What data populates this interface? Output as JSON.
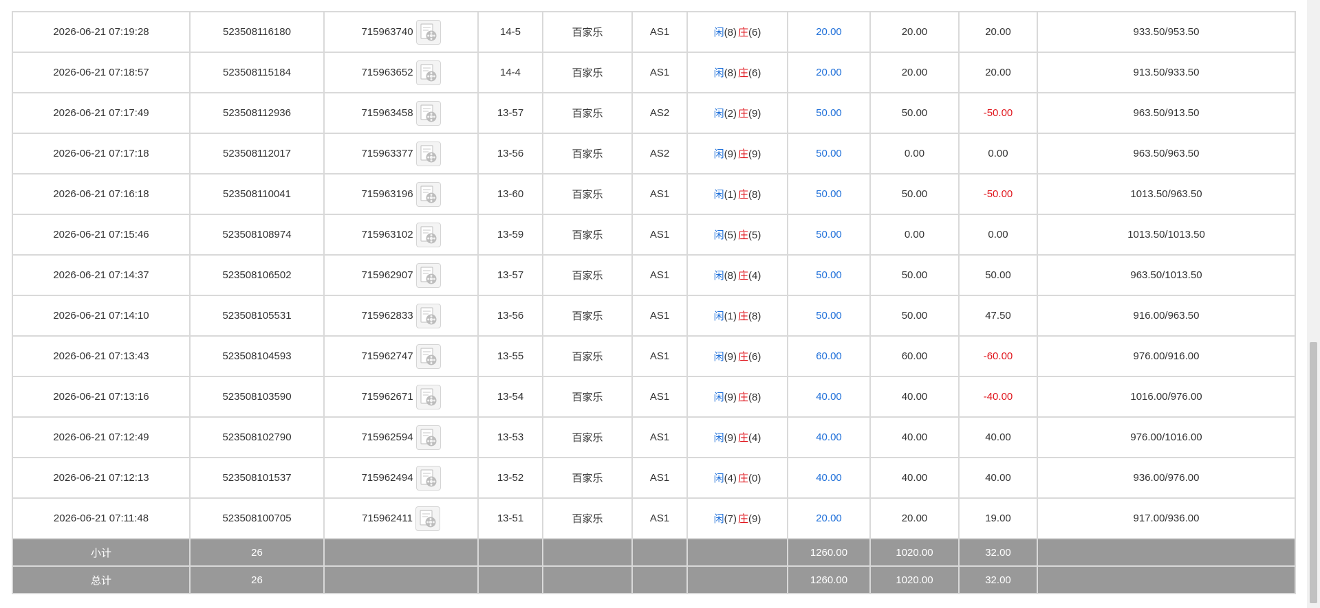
{
  "rows": [
    {
      "time": "2026-06-21 07:19:28",
      "order_no": "523508116180",
      "room_no": "715963740",
      "round": "14-5",
      "game": "百家乐",
      "table": "AS1",
      "player_label": "闲",
      "player_pts": "(8)",
      "banker_label": "庄",
      "banker_pts": "(6)",
      "bet": "20.00",
      "valid_bet": "20.00",
      "win_loss": "20.00",
      "wl_color": "normal",
      "balance": "933.50/953.50"
    },
    {
      "time": "2026-06-21 07:18:57",
      "order_no": "523508115184",
      "room_no": "715963652",
      "round": "14-4",
      "game": "百家乐",
      "table": "AS1",
      "player_label": "闲",
      "player_pts": "(8)",
      "banker_label": "庄",
      "banker_pts": "(6)",
      "bet": "20.00",
      "valid_bet": "20.00",
      "win_loss": "20.00",
      "wl_color": "normal",
      "balance": "913.50/933.50"
    },
    {
      "time": "2026-06-21 07:17:49",
      "order_no": "523508112936",
      "room_no": "715963458",
      "round": "13-57",
      "game": "百家乐",
      "table": "AS2",
      "player_label": "闲",
      "player_pts": "(2)",
      "banker_label": "庄",
      "banker_pts": "(9)",
      "bet": "50.00",
      "valid_bet": "50.00",
      "win_loss": "-50.00",
      "wl_color": "red",
      "balance": "963.50/913.50"
    },
    {
      "time": "2026-06-21 07:17:18",
      "order_no": "523508112017",
      "room_no": "715963377",
      "round": "13-56",
      "game": "百家乐",
      "table": "AS2",
      "player_label": "闲",
      "player_pts": "(9)",
      "banker_label": "庄",
      "banker_pts": "(9)",
      "bet": "50.00",
      "valid_bet": "0.00",
      "win_loss": "0.00",
      "wl_color": "normal",
      "balance": "963.50/963.50"
    },
    {
      "time": "2026-06-21 07:16:18",
      "order_no": "523508110041",
      "room_no": "715963196",
      "round": "13-60",
      "game": "百家乐",
      "table": "AS1",
      "player_label": "闲",
      "player_pts": "(1)",
      "banker_label": "庄",
      "banker_pts": "(8)",
      "bet": "50.00",
      "valid_bet": "50.00",
      "win_loss": "-50.00",
      "wl_color": "red",
      "balance": "1013.50/963.50"
    },
    {
      "time": "2026-06-21 07:15:46",
      "order_no": "523508108974",
      "room_no": "715963102",
      "round": "13-59",
      "game": "百家乐",
      "table": "AS1",
      "player_label": "闲",
      "player_pts": "(5)",
      "banker_label": "庄",
      "banker_pts": "(5)",
      "bet": "50.00",
      "valid_bet": "0.00",
      "win_loss": "0.00",
      "wl_color": "normal",
      "balance": "1013.50/1013.50"
    },
    {
      "time": "2026-06-21 07:14:37",
      "order_no": "523508106502",
      "room_no": "715962907",
      "round": "13-57",
      "game": "百家乐",
      "table": "AS1",
      "player_label": "闲",
      "player_pts": "(8)",
      "banker_label": "庄",
      "banker_pts": "(4)",
      "bet": "50.00",
      "valid_bet": "50.00",
      "win_loss": "50.00",
      "wl_color": "normal",
      "balance": "963.50/1013.50"
    },
    {
      "time": "2026-06-21 07:14:10",
      "order_no": "523508105531",
      "room_no": "715962833",
      "round": "13-56",
      "game": "百家乐",
      "table": "AS1",
      "player_label": "闲",
      "player_pts": "(1)",
      "banker_label": "庄",
      "banker_pts": "(8)",
      "bet": "50.00",
      "valid_bet": "50.00",
      "win_loss": "47.50",
      "wl_color": "normal",
      "balance": "916.00/963.50"
    },
    {
      "time": "2026-06-21 07:13:43",
      "order_no": "523508104593",
      "room_no": "715962747",
      "round": "13-55",
      "game": "百家乐",
      "table": "AS1",
      "player_label": "闲",
      "player_pts": "(9)",
      "banker_label": "庄",
      "banker_pts": "(6)",
      "bet": "60.00",
      "valid_bet": "60.00",
      "win_loss": "-60.00",
      "wl_color": "red",
      "balance": "976.00/916.00"
    },
    {
      "time": "2026-06-21 07:13:16",
      "order_no": "523508103590",
      "room_no": "715962671",
      "round": "13-54",
      "game": "百家乐",
      "table": "AS1",
      "player_label": "闲",
      "player_pts": "(9)",
      "banker_label": "庄",
      "banker_pts": "(8)",
      "bet": "40.00",
      "valid_bet": "40.00",
      "win_loss": "-40.00",
      "wl_color": "red",
      "balance": "1016.00/976.00"
    },
    {
      "time": "2026-06-21 07:12:49",
      "order_no": "523508102790",
      "room_no": "715962594",
      "round": "13-53",
      "game": "百家乐",
      "table": "AS1",
      "player_label": "闲",
      "player_pts": "(9)",
      "banker_label": "庄",
      "banker_pts": "(4)",
      "bet": "40.00",
      "valid_bet": "40.00",
      "win_loss": "40.00",
      "wl_color": "normal",
      "balance": "976.00/1016.00"
    },
    {
      "time": "2026-06-21 07:12:13",
      "order_no": "523508101537",
      "room_no": "715962494",
      "round": "13-52",
      "game": "百家乐",
      "table": "AS1",
      "player_label": "闲",
      "player_pts": "(4)",
      "banker_label": "庄",
      "banker_pts": "(0)",
      "bet": "40.00",
      "valid_bet": "40.00",
      "win_loss": "40.00",
      "wl_color": "normal",
      "balance": "936.00/976.00"
    },
    {
      "time": "2026-06-21 07:11:48",
      "order_no": "523508100705",
      "room_no": "715962411",
      "round": "13-51",
      "game": "百家乐",
      "table": "AS1",
      "player_label": "闲",
      "player_pts": "(7)",
      "banker_label": "庄",
      "banker_pts": "(9)",
      "bet": "20.00",
      "valid_bet": "20.00",
      "win_loss": "19.00",
      "wl_color": "normal",
      "balance": "917.00/936.00"
    }
  ],
  "subtotal": {
    "label": "小计",
    "count": "26",
    "bet": "1260.00",
    "valid_bet": "1020.00",
    "win_loss": "32.00"
  },
  "total": {
    "label": "总计",
    "count": "26",
    "bet": "1260.00",
    "valid_bet": "1020.00",
    "win_loss": "32.00"
  },
  "colors": {
    "blue_text": "#1e6fd9",
    "red_text": "#e0161d",
    "summary_bg": "#999999",
    "border": "#d9d9d9"
  },
  "icons": {
    "replay": "video-replay-icon"
  }
}
